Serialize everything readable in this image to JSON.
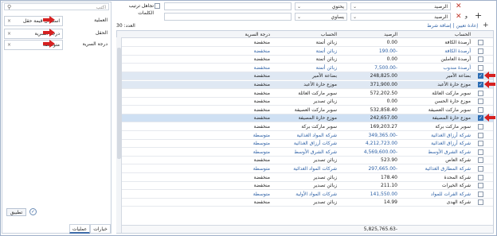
{
  "left_panel": {
    "search_placeholder": "اكتب",
    "rows": [
      {
        "label": "العملية",
        "value": "استبدال قيمة حقل",
        "arrow": true
      },
      {
        "label": "الحقل",
        "value": "درجة السرية",
        "arrow": true
      },
      {
        "label": "درجة السرية",
        "value": "متوسطة",
        "arrow": true
      }
    ],
    "apply_label": "تطبيق",
    "tabs": [
      "عمليات",
      "خيارات"
    ]
  },
  "toolbar": {
    "filter1": {
      "field": "الرصيد",
      "op": "يحتوي"
    },
    "filter2": {
      "field": "الرصيد",
      "op": "يساوي"
    },
    "and_label": "و",
    "cancel_sort_label": "تجاهل ترتيب الكلمات",
    "add_condition": "إضافة شرط جديد",
    "reset": "إعادة تعيين",
    "count_label": "العدد: 30"
  },
  "table": {
    "columns": [
      "الحساب",
      "الرصيد",
      "الحساب",
      "درجة السرية"
    ],
    "rows": [
      {
        "account": "أرصدة الكافة",
        "balance": "0.00",
        "name": "زبائن أتمتة",
        "secrecy": "منخفضة",
        "blue": false
      },
      {
        "account": "أرصدة الكافة",
        "balance": "190.00-",
        "name": "زبائن أتمتة",
        "secrecy": "منخفضة",
        "blue": true
      },
      {
        "account": "أرصدة العاملين",
        "balance": "0.00",
        "name": "زبائن أتمتة",
        "secrecy": "منخفضة",
        "blue": false
      },
      {
        "account": "أرصدة مندوب",
        "balance": "7,500.00-",
        "name": "زبائن أتمتة",
        "secrecy": "منخفضة",
        "blue": true
      },
      {
        "account": "بضاعة الأمير",
        "balance": "248,825.00",
        "name": "بضاعة الأمير",
        "secrecy": "منخفضة",
        "blue": false,
        "checked": true,
        "row": "sel"
      },
      {
        "account": "موزع حارة الأعبد",
        "balance": "371,900.00",
        "name": "موزع حارة الأعبد",
        "secrecy": "منخفضة",
        "blue": false,
        "checked": true,
        "row": "sel"
      },
      {
        "account": "سوبر ماركت العائلة",
        "balance": "572,202.50",
        "name": "سوبر ماركت العائلة",
        "secrecy": "منخفضة",
        "blue": false
      },
      {
        "account": "موزع حارة الحسن",
        "balance": "0.00",
        "name": "زبائن تصدير",
        "secrecy": "منخفضة",
        "blue": false
      },
      {
        "account": "سوبر ماركت العصيفة",
        "balance": "532,858.40",
        "name": "سوبر ماركت العصيفة",
        "secrecy": "منخفضة",
        "blue": false
      },
      {
        "account": "موزع حارة المصيفة",
        "balance": "242,657.00",
        "name": "موزع حارة المصيفة",
        "secrecy": "منخفضة",
        "blue": false,
        "checked": true,
        "row": "hl"
      },
      {
        "account": "سوبر ماركت بركة",
        "balance": "169,203.27",
        "name": "سوبر ماركت بركة",
        "secrecy": "منخفضة",
        "blue": false
      },
      {
        "account": "شركة أرزاق الغذائية",
        "balance": "349,365.00-",
        "name": "شركة المواد الغذائية",
        "secrecy": "متوسطة",
        "blue": true
      },
      {
        "account": "شركة أرزاق الغذائية",
        "balance": "4,212,723.00",
        "name": "شركات أرزاق الغذائية",
        "secrecy": "متوسطة",
        "blue": true
      },
      {
        "account": "شركة الشرق الأوسط",
        "balance": "4,569,600.00-",
        "name": "شركة الشرق الأوسط",
        "secrecy": "متوسطة",
        "blue": true
      },
      {
        "account": "شركة العاص",
        "balance": "523.90",
        "name": "زبائن تصدير",
        "secrecy": "منخفضة",
        "blue": false
      },
      {
        "account": "شركة المطارق الغذائية",
        "balance": "297,665.00-",
        "name": "شركات المواد الغذائية",
        "secrecy": "متوسطة",
        "blue": true
      },
      {
        "account": "شركة المحدة",
        "balance": "178.40",
        "name": "زبائن تصدير",
        "secrecy": "منخفضة",
        "blue": false
      },
      {
        "account": "شركة الخيرات",
        "balance": "211.10",
        "name": "زبائن تصدير",
        "secrecy": "منخفضة",
        "blue": false
      },
      {
        "account": "شركة الفرات للمواد",
        "balance": "141,550.00",
        "name": "شركات المواد الأولية",
        "secrecy": "متوسطة",
        "blue": true
      },
      {
        "account": "شركة الهدى",
        "balance": "14.99",
        "name": "زبائن تصدير",
        "secrecy": "منخفضة",
        "blue": false
      }
    ],
    "total": "5,825,765.63-"
  },
  "colors": {
    "accent": "#2b6cb3",
    "arrow": "#d62020",
    "link": "#2b5fa5"
  }
}
